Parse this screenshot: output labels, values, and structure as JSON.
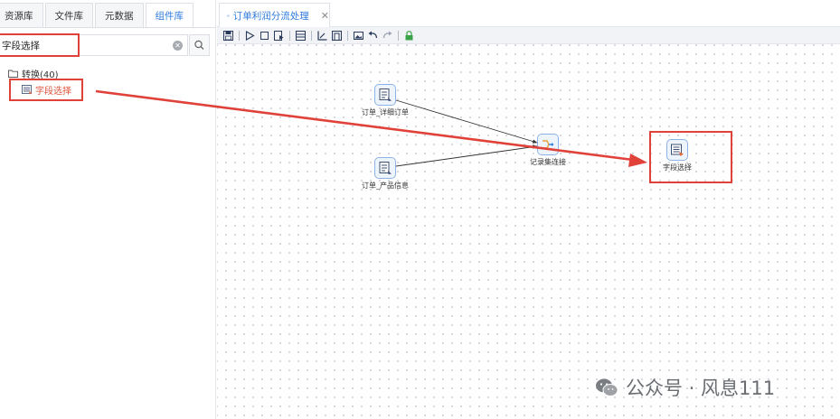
{
  "left_tabs": [
    {
      "label": "资源库"
    },
    {
      "label": "文件库"
    },
    {
      "label": "元数据"
    },
    {
      "label": "组件库",
      "active": true
    }
  ],
  "search": {
    "value": "字段选择",
    "placeholder": ""
  },
  "tree": {
    "folder_label": "转换(40)",
    "item_label": "字段选择"
  },
  "doc_tab": {
    "title": "订单利润分流处理"
  },
  "canvas": {
    "nodes": [
      {
        "label": "订单_详细订单",
        "icon": "table-input-icon"
      },
      {
        "label": "订单_产品信息",
        "icon": "table-input-icon"
      },
      {
        "label": "记录集连接",
        "icon": "merge-join-icon"
      },
      {
        "label": "字段选择",
        "icon": "select-values-icon"
      }
    ]
  },
  "watermark": {
    "text": "公众号 · 风息111"
  },
  "colors": {
    "accent": "#2f7bdd",
    "annotation": "#e0423a",
    "tree_item": "#e0533a"
  }
}
